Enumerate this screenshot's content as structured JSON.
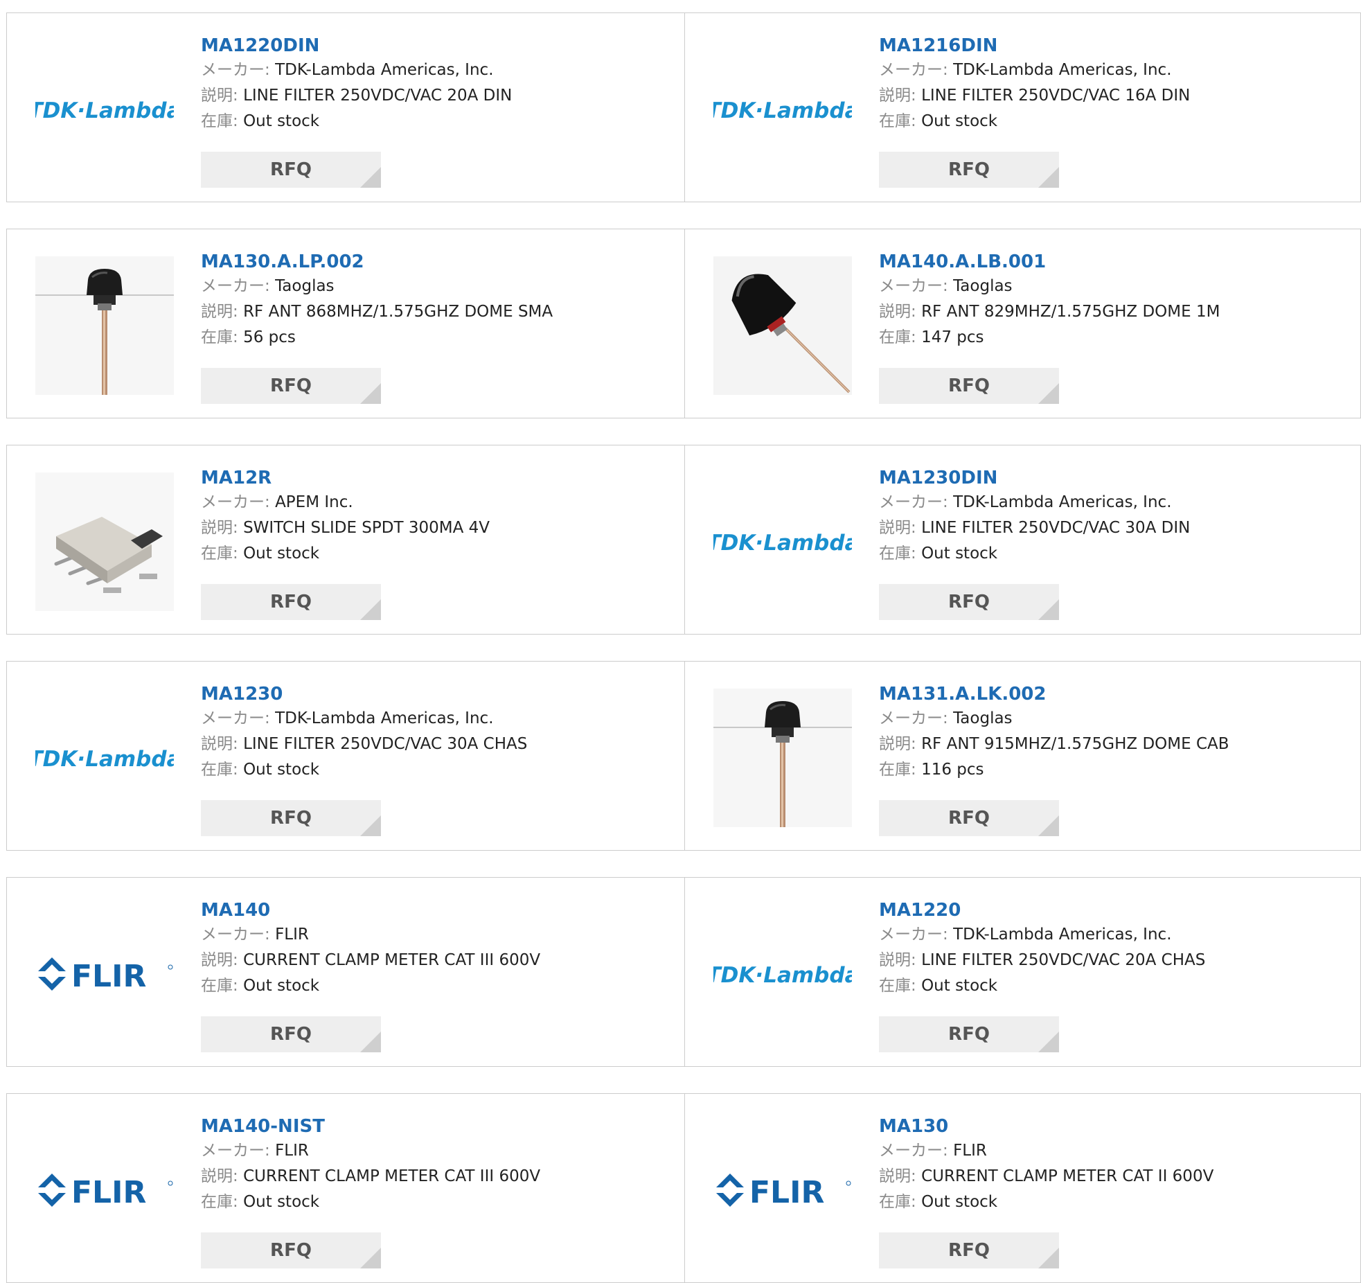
{
  "labels": {
    "maker": "メーカー:",
    "description": "説明:",
    "stock": "在庫:",
    "rfq": "RFQ"
  },
  "colors": {
    "part_link": "#1e6bb3",
    "tdk_logo": "#1a90cf",
    "flir_logo": "#1463a8",
    "border": "#cccccc",
    "rfq_bg": "#eeeeee"
  },
  "logo_text": {
    "tdk": "TDK·Lambda",
    "flir": "FLIR"
  },
  "products": [
    {
      "part": "MA1220DIN",
      "maker": "TDK-Lambda Americas, Inc.",
      "description": "LINE FILTER 250VDC/VAC 20A DIN",
      "stock": "Out stock",
      "image": "tdk-lambda-logo"
    },
    {
      "part": "MA1216DIN",
      "maker": "TDK-Lambda Americas, Inc.",
      "description": "LINE FILTER 250VDC/VAC 16A DIN",
      "stock": "Out stock",
      "image": "tdk-lambda-logo"
    },
    {
      "part": "MA130.A.LP.002",
      "maker": "Taoglas",
      "description": "RF ANT 868MHZ/1.575GHZ DOME SMA",
      "stock": "56 pcs",
      "image": "dome-antenna-photo"
    },
    {
      "part": "MA140.A.LB.001",
      "maker": "Taoglas",
      "description": "RF ANT 829MHZ/1.575GHZ DOME 1M",
      "stock": "147 pcs",
      "image": "tilted-antenna-photo"
    },
    {
      "part": "MA12R",
      "maker": "APEM Inc.",
      "description": "SWITCH SLIDE SPDT 300MA 4V",
      "stock": "Out stock",
      "image": "slide-switch-photo"
    },
    {
      "part": "MA1230DIN",
      "maker": "TDK-Lambda Americas, Inc.",
      "description": "LINE FILTER 250VDC/VAC 30A DIN",
      "stock": "Out stock",
      "image": "tdk-lambda-logo"
    },
    {
      "part": "MA1230",
      "maker": "TDK-Lambda Americas, Inc.",
      "description": "LINE FILTER 250VDC/VAC 30A CHAS",
      "stock": "Out stock",
      "image": "tdk-lambda-logo"
    },
    {
      "part": "MA131.A.LK.002",
      "maker": "Taoglas",
      "description": "RF ANT 915MHZ/1.575GHZ DOME CAB",
      "stock": "116 pcs",
      "image": "dome-antenna-photo"
    },
    {
      "part": "MA140",
      "maker": "FLIR",
      "description": "CURRENT CLAMP METER CAT III 600V",
      "stock": "Out stock",
      "image": "flir-logo"
    },
    {
      "part": "MA1220",
      "maker": "TDK-Lambda Americas, Inc.",
      "description": "LINE FILTER 250VDC/VAC 20A CHAS",
      "stock": "Out stock",
      "image": "tdk-lambda-logo"
    },
    {
      "part": "MA140-NIST",
      "maker": "FLIR",
      "description": "CURRENT CLAMP METER CAT III 600V",
      "stock": "Out stock",
      "image": "flir-logo"
    },
    {
      "part": "MA130",
      "maker": "FLIR",
      "description": "CURRENT CLAMP METER CAT II 600V",
      "stock": "Out stock",
      "image": "flir-logo"
    }
  ]
}
